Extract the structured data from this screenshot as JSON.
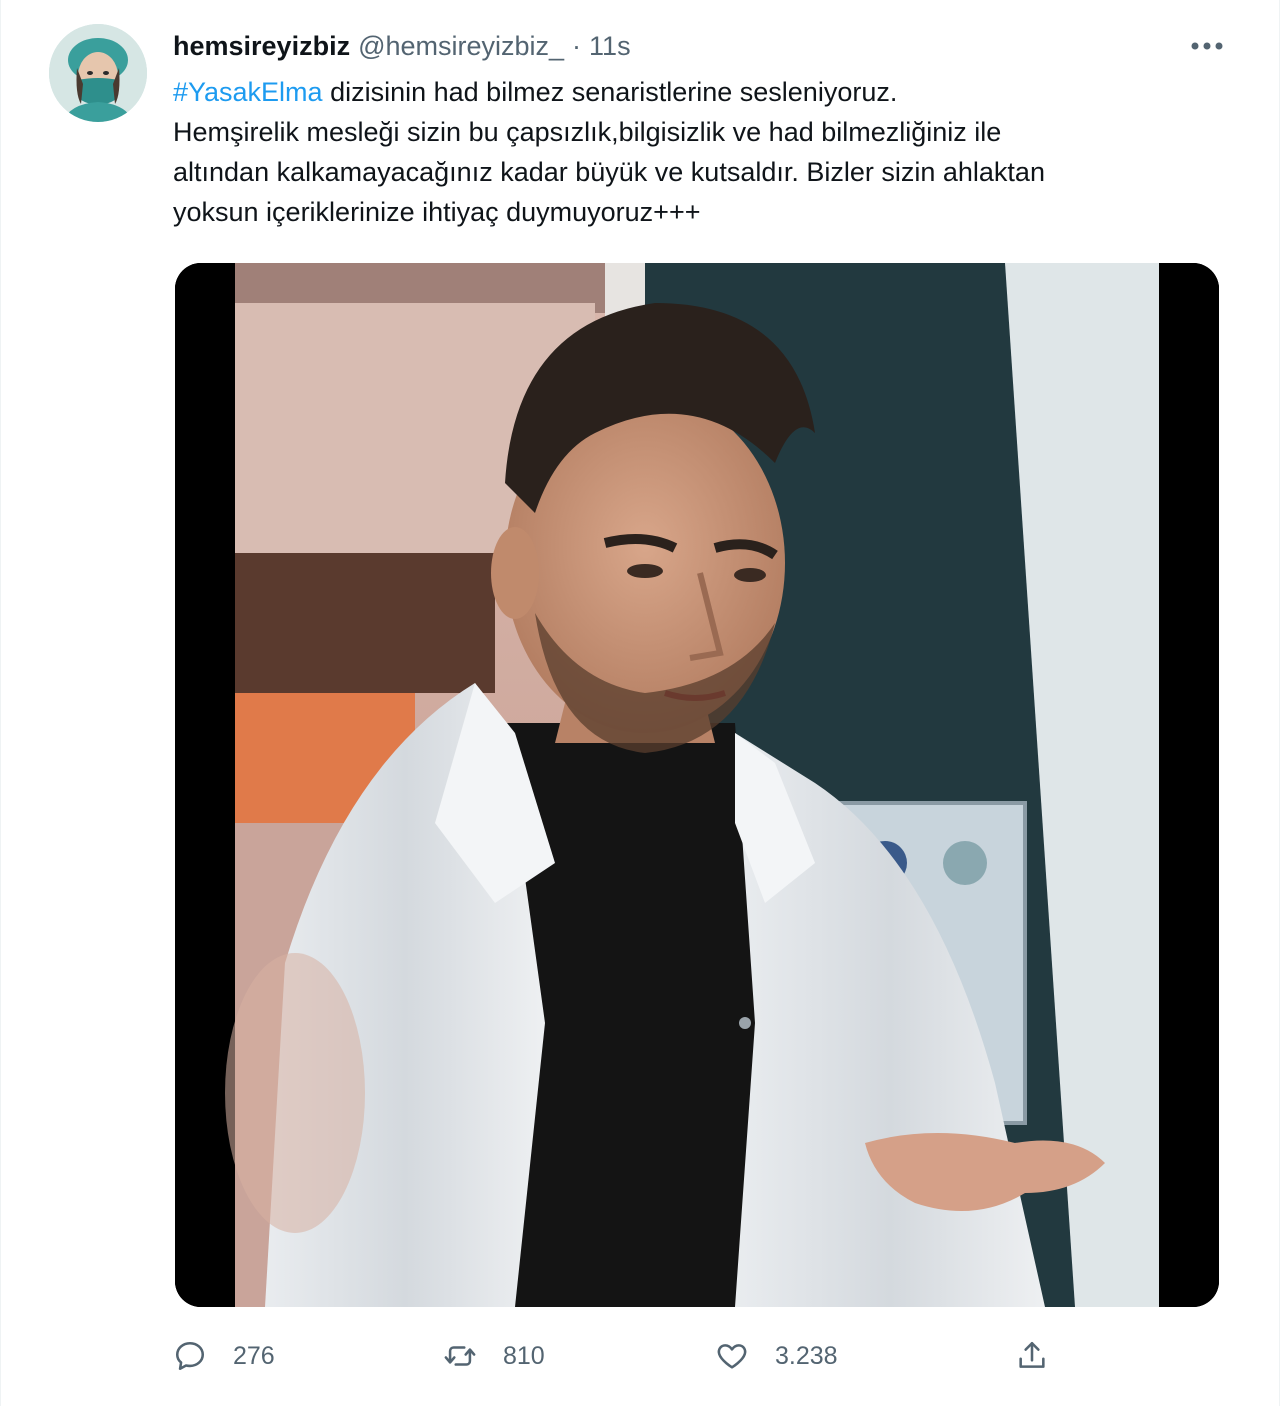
{
  "tweet": {
    "display_name": "hemsireyizbiz",
    "handle": "@hemsireyizbiz_",
    "separator": "·",
    "time": "11s",
    "text": {
      "hashtag": "#YasakElma",
      "line1_rest": " dizisinin had bilmez senaristlerine sesleniyoruz.",
      "line2": "Hemşirelik mesleği sizin bu çapsızlık,bilgisizlik ve had bilmezliğiniz ile",
      "line3": "altından kalkamayacağınız kadar büyük ve kutsaldır. Bizler sizin ahlaktan",
      "line4": "yoksun içeriklerinize ihtiyaç duymuyoruz+++"
    },
    "icons": {
      "avatar": "nurse-avatar",
      "more": "more-dots-icon",
      "reply": "reply-icon",
      "retweet": "retweet-icon",
      "like": "heart-icon",
      "share": "share-icon"
    },
    "stats": {
      "replies": "276",
      "retweets": "810",
      "likes": "3.238"
    },
    "colors": {
      "link": "#1d9bf0",
      "secondary_text": "#536471",
      "primary_text": "#0f1419"
    }
  }
}
